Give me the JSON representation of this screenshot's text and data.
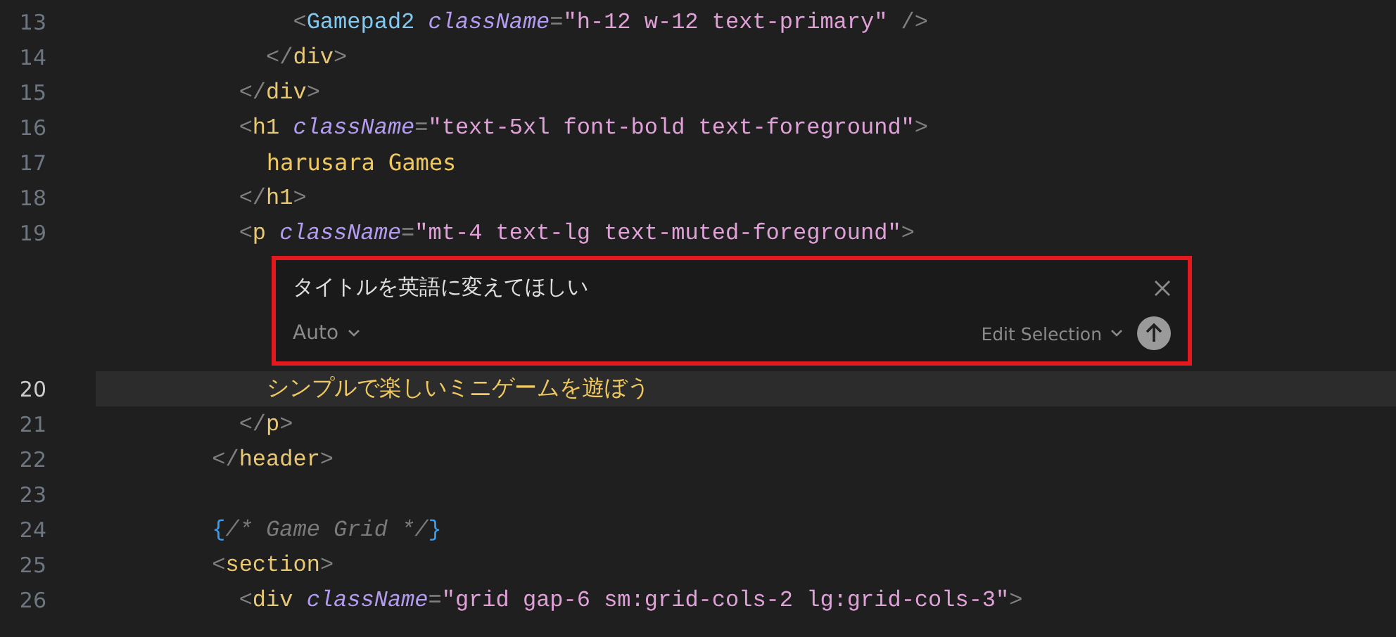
{
  "editor": {
    "lines_before": [
      {
        "number": "13",
        "current": false,
        "tokens": [
          {
            "kind": "punct",
            "text": "            <"
          },
          {
            "kind": "component",
            "text": "Gamepad2"
          },
          {
            "kind": "attr",
            "text": " className"
          },
          {
            "kind": "punct",
            "text": "="
          },
          {
            "kind": "string",
            "text": "\"h-12 w-12 text-primary\""
          },
          {
            "kind": "punct",
            "text": " />"
          }
        ]
      },
      {
        "number": "14",
        "current": false,
        "tokens": [
          {
            "kind": "punct",
            "text": "          </"
          },
          {
            "kind": "tag",
            "text": "div"
          },
          {
            "kind": "punct",
            "text": ">"
          }
        ]
      },
      {
        "number": "15",
        "current": false,
        "tokens": [
          {
            "kind": "punct",
            "text": "        </"
          },
          {
            "kind": "tag",
            "text": "div"
          },
          {
            "kind": "punct",
            "text": ">"
          }
        ]
      },
      {
        "number": "16",
        "current": false,
        "tokens": [
          {
            "kind": "punct",
            "text": "        <"
          },
          {
            "kind": "tag",
            "text": "h1"
          },
          {
            "kind": "attr",
            "text": " className"
          },
          {
            "kind": "punct",
            "text": "="
          },
          {
            "kind": "string",
            "text": "\"text-5xl font-bold text-foreground\""
          },
          {
            "kind": "punct",
            "text": ">"
          }
        ]
      },
      {
        "number": "17",
        "current": false,
        "tokens": [
          {
            "kind": "text",
            "text": "          harusara Games"
          }
        ]
      },
      {
        "number": "18",
        "current": false,
        "tokens": [
          {
            "kind": "punct",
            "text": "        </"
          },
          {
            "kind": "tag",
            "text": "h1"
          },
          {
            "kind": "punct",
            "text": ">"
          }
        ]
      },
      {
        "number": "19",
        "current": false,
        "tokens": [
          {
            "kind": "punct",
            "text": "        <"
          },
          {
            "kind": "tag",
            "text": "p"
          },
          {
            "kind": "attr",
            "text": " className"
          },
          {
            "kind": "punct",
            "text": "="
          },
          {
            "kind": "string",
            "text": "\"mt-4 text-lg text-muted-foreground\""
          },
          {
            "kind": "punct",
            "text": ">"
          }
        ]
      }
    ],
    "inline_chat": {
      "prompt": "タイトルを英語に変えてほしい",
      "mode": "Auto",
      "action": "Edit Selection"
    },
    "lines_after": [
      {
        "number": "20",
        "current": true,
        "tokens": [
          {
            "kind": "text",
            "text": "          シンプルで楽しいミニゲームを遊ぼう"
          }
        ]
      },
      {
        "number": "21",
        "current": false,
        "tokens": [
          {
            "kind": "punct",
            "text": "        </"
          },
          {
            "kind": "tag",
            "text": "p"
          },
          {
            "kind": "punct",
            "text": ">"
          }
        ]
      },
      {
        "number": "22",
        "current": false,
        "tokens": [
          {
            "kind": "punct",
            "text": "      </"
          },
          {
            "kind": "tag",
            "text": "header"
          },
          {
            "kind": "punct",
            "text": ">"
          }
        ]
      },
      {
        "number": "23",
        "current": false
      },
      {
        "number": "24",
        "current": false,
        "tokens": [
          {
            "kind": "brace",
            "text": "      {"
          },
          {
            "kind": "comment",
            "text": "/* Game Grid */"
          },
          {
            "kind": "brace",
            "text": "}"
          }
        ]
      },
      {
        "number": "25",
        "current": false,
        "tokens": [
          {
            "kind": "punct",
            "text": "      <"
          },
          {
            "kind": "tag",
            "text": "section"
          },
          {
            "kind": "punct",
            "text": ">"
          }
        ]
      },
      {
        "number": "26",
        "current": false,
        "tokens": [
          {
            "kind": "punct",
            "text": "        <"
          },
          {
            "kind": "tag",
            "text": "div"
          },
          {
            "kind": "attr",
            "text": " className"
          },
          {
            "kind": "punct",
            "text": "="
          },
          {
            "kind": "string",
            "text": "\"grid gap-6 sm:grid-cols-2 lg:grid-cols-3\""
          },
          {
            "kind": "punct",
            "text": ">"
          }
        ]
      }
    ]
  }
}
